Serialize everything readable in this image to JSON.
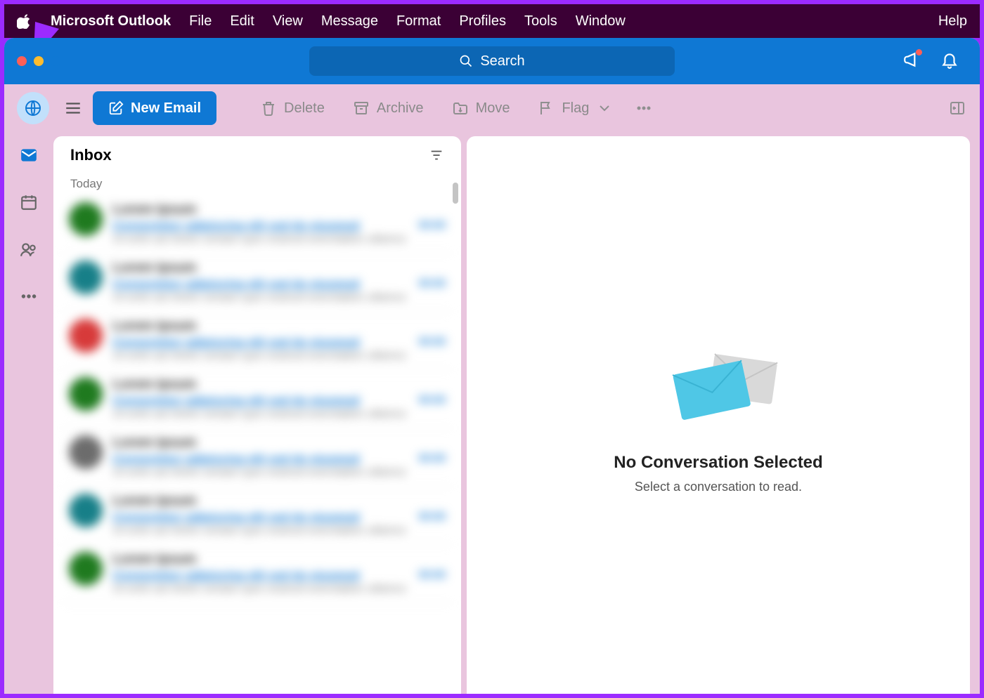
{
  "menubar": {
    "app_name": "Microsoft Outlook",
    "items": [
      "File",
      "Edit",
      "View",
      "Message",
      "Format",
      "Profiles",
      "Tools",
      "Window"
    ],
    "help": "Help"
  },
  "titlebar": {
    "search_placeholder": "Search"
  },
  "toolbar": {
    "new_email": "New Email",
    "delete": "Delete",
    "archive": "Archive",
    "move": "Move",
    "flag": "Flag"
  },
  "list": {
    "title": "Inbox",
    "section": "Today"
  },
  "reading": {
    "title": "No Conversation Selected",
    "subtitle": "Select a conversation to read."
  },
  "blurred_emails": [
    {
      "color": "#1f7a1f"
    },
    {
      "color": "#177f88"
    },
    {
      "color": "#d73a3a"
    },
    {
      "color": "#1f7a1f"
    },
    {
      "color": "#6c6c6c"
    },
    {
      "color": "#177f88"
    },
    {
      "color": "#1f7a1f"
    }
  ]
}
